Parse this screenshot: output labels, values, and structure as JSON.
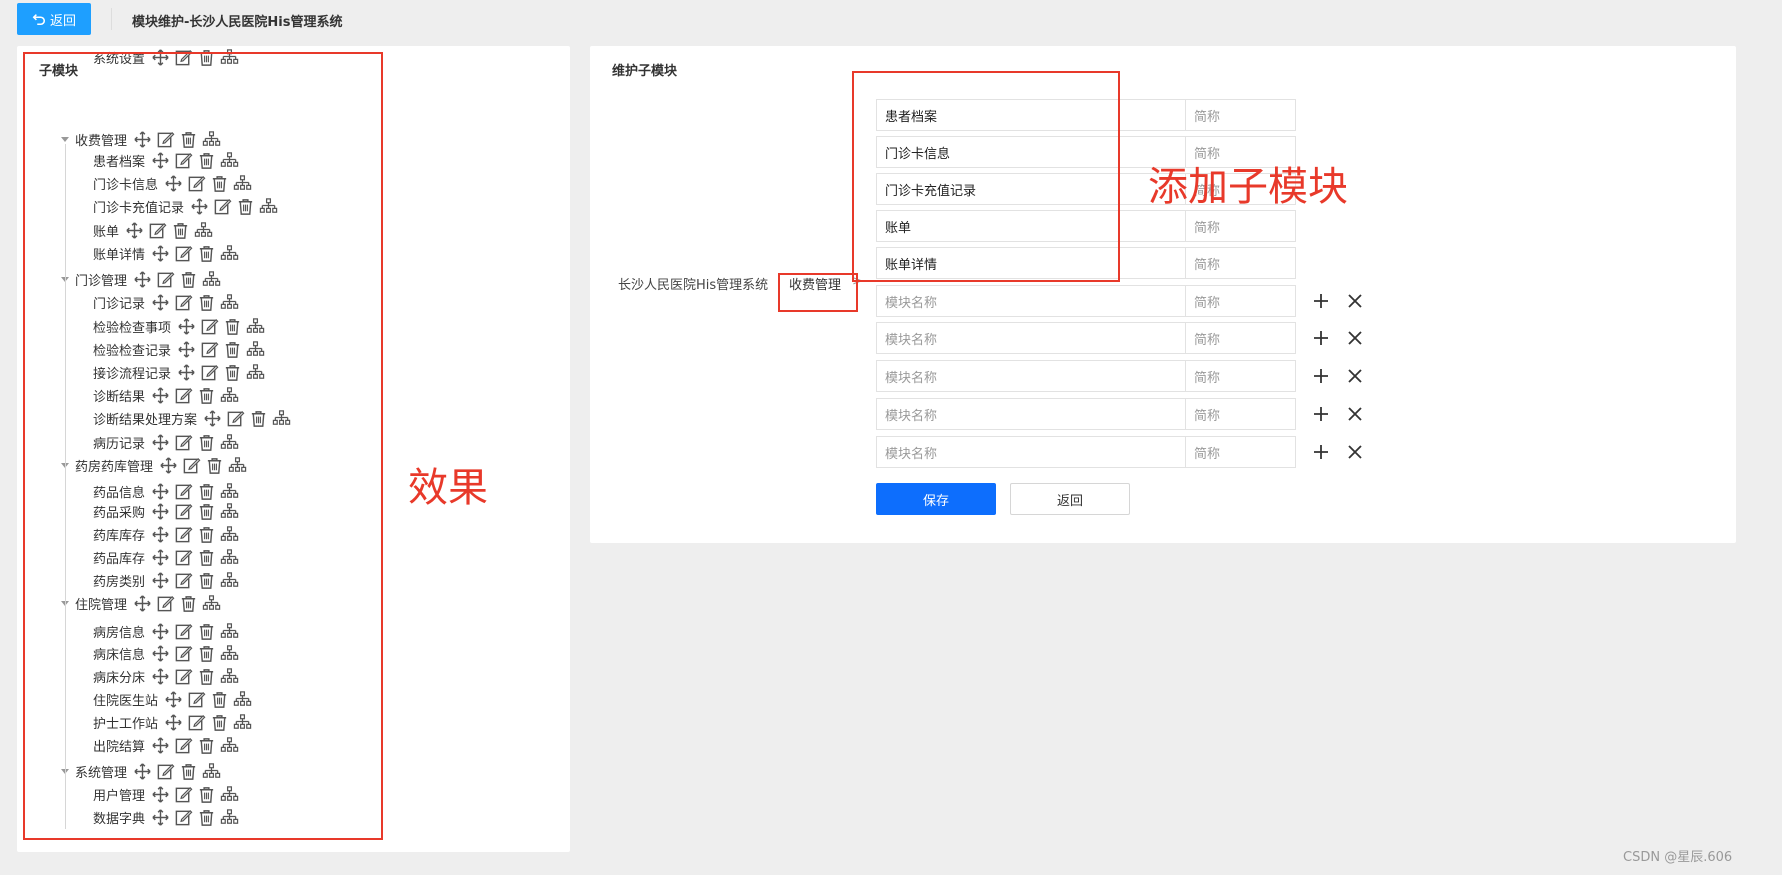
{
  "header": {
    "back_label": "返回",
    "title": "模块维护-长沙人民医院His管理系统"
  },
  "left": {
    "title": "子模块",
    "annotation": "效果",
    "tree": [
      {
        "label": "收费管理",
        "children": [
          "患者档案",
          "门诊卡信息",
          "门诊卡充值记录",
          "账单",
          "账单详情"
        ]
      },
      {
        "label": "门诊管理",
        "children": [
          "门诊记录",
          "检验检查事项",
          "检验检查记录",
          "接诊流程记录",
          "诊断结果",
          "诊断结果处理方案",
          "病历记录"
        ]
      },
      {
        "label": "药房药库管理",
        "children": [
          "药品信息",
          "药品采购",
          "药库库存",
          "药品库存",
          "药房类别"
        ]
      },
      {
        "label": "住院管理",
        "children": [
          "病房信息",
          "病床信息",
          "病床分床",
          "住院医生站",
          "护士工作站",
          "出院结算"
        ]
      },
      {
        "label": "系统管理",
        "children": [
          "用户管理",
          "数据字典",
          "系统设置"
        ]
      }
    ]
  },
  "right": {
    "title": "维护子模块",
    "annotation": "添加子模块",
    "breadcrumb": {
      "root": "长沙人民医院His管理系统",
      "current": "收费管理",
      "separator": ">"
    },
    "rows": [
      {
        "name": "患者档案",
        "abbr_placeholder": "简称",
        "new": false
      },
      {
        "name": "门诊卡信息",
        "abbr_placeholder": "简称",
        "new": false
      },
      {
        "name": "门诊卡充值记录",
        "abbr_placeholder": "简称",
        "new": false
      },
      {
        "name": "账单",
        "abbr_placeholder": "简称",
        "new": false
      },
      {
        "name": "账单详情",
        "abbr_placeholder": "简称",
        "new": false
      },
      {
        "name": "",
        "name_placeholder": "模块名称",
        "abbr_placeholder": "简称",
        "new": true
      },
      {
        "name": "",
        "name_placeholder": "模块名称",
        "abbr_placeholder": "简称",
        "new": true
      },
      {
        "name": "",
        "name_placeholder": "模块名称",
        "abbr_placeholder": "简称",
        "new": true
      },
      {
        "name": "",
        "name_placeholder": "模块名称",
        "abbr_placeholder": "简称",
        "new": true
      },
      {
        "name": "",
        "name_placeholder": "模块名称",
        "abbr_placeholder": "简称",
        "new": true
      }
    ],
    "save_label": "保存",
    "return_label": "返回"
  },
  "watermark": "CSDN @星辰.606",
  "colors": {
    "primary": "#1e9fff",
    "save": "#0d6efd",
    "annotation": "#e8392a"
  }
}
